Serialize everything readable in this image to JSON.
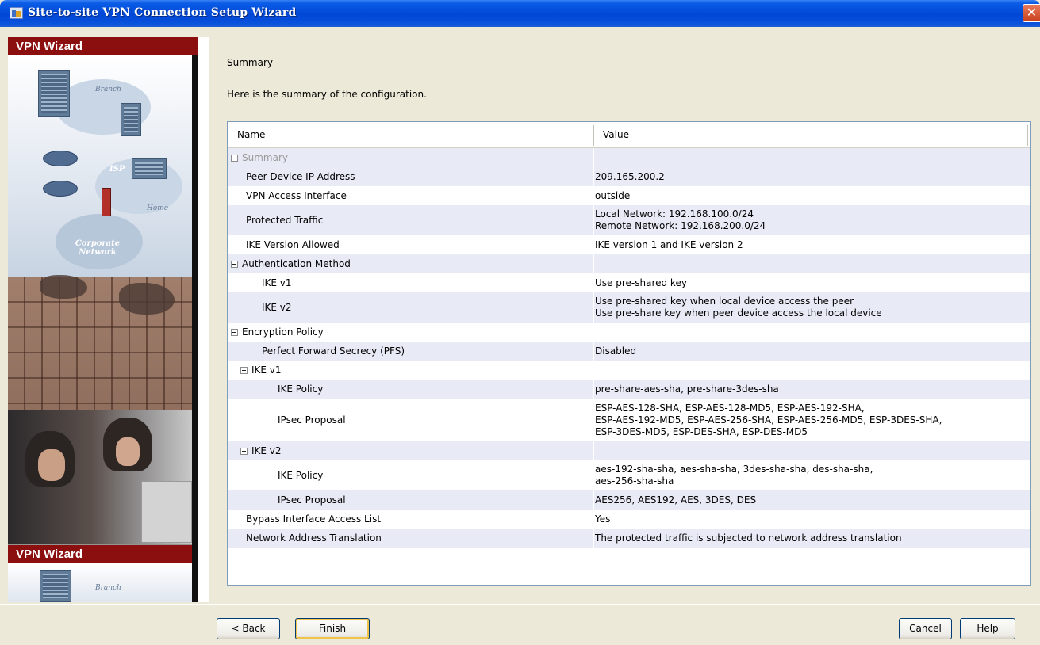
{
  "window": {
    "title": "Site-to-site VPN Connection Setup Wizard",
    "close_glyph": "✕"
  },
  "sidebar": {
    "label_top": "VPN Wizard",
    "label_bottom": "VPN Wizard",
    "illustration_labels": {
      "branch": "Branch",
      "isp": "ISP",
      "home": "Home",
      "corporate_network": "Corporate Network",
      "branch_bottom": "Branch"
    }
  },
  "page": {
    "title": "Summary",
    "subtitle": "Here is the summary of the configuration."
  },
  "table": {
    "columns": [
      "Name",
      "Value"
    ],
    "rows": [
      {
        "name": "Summary",
        "value": "",
        "level": 0,
        "expander": true,
        "grey": true,
        "alt": true
      },
      {
        "name": "Peer Device IP Address",
        "value": "209.165.200.2",
        "level": 1,
        "alt": true
      },
      {
        "name": "VPN Access Interface",
        "value": "outside",
        "level": 1,
        "alt": false
      },
      {
        "name": "Protected Traffic",
        "value": "Local Network: 192.168.100.0/24\nRemote Network: 192.168.200.0/24",
        "level": 1,
        "alt": true
      },
      {
        "name": "IKE Version Allowed",
        "value": "IKE version 1 and IKE version 2",
        "level": 1,
        "alt": false
      },
      {
        "name": "Authentication Method",
        "value": "",
        "level": 0,
        "expander": true,
        "alt": true
      },
      {
        "name": "IKE v1",
        "value": "Use pre-shared key",
        "level": 2,
        "alt": false
      },
      {
        "name": "IKE v2",
        "value": "Use pre-shared key when local device access the peer\nUse pre-share key when peer device access the local device",
        "level": 2,
        "alt": true
      },
      {
        "name": "Encryption Policy",
        "value": "",
        "level": 0,
        "expander": true,
        "alt": false
      },
      {
        "name": "Perfect Forward Secrecy (PFS)",
        "value": "Disabled",
        "level": 2,
        "alt": true
      },
      {
        "name": "IKE v1",
        "value": "",
        "level": 1,
        "expander": true,
        "alt": false
      },
      {
        "name": "IKE Policy",
        "value": "pre-share-aes-sha, pre-share-3des-sha",
        "level": 3,
        "alt": true
      },
      {
        "name": "IPsec Proposal",
        "value": "ESP-AES-128-SHA, ESP-AES-128-MD5, ESP-AES-192-SHA,\nESP-AES-192-MD5, ESP-AES-256-SHA, ESP-AES-256-MD5, ESP-3DES-SHA,\nESP-3DES-MD5, ESP-DES-SHA, ESP-DES-MD5",
        "level": 3,
        "alt": false
      },
      {
        "name": "IKE v2",
        "value": "",
        "level": 1,
        "expander": true,
        "alt": true
      },
      {
        "name": "IKE Policy",
        "value": "aes-192-sha-sha, aes-sha-sha, 3des-sha-sha, des-sha-sha,\naes-256-sha-sha",
        "level": 3,
        "alt": false
      },
      {
        "name": "IPsec Proposal",
        "value": "AES256, AES192, AES, 3DES, DES",
        "level": 3,
        "alt": true
      },
      {
        "name": "Bypass Interface Access List",
        "value": "Yes",
        "level": 1,
        "alt": false
      },
      {
        "name": "Network Address Translation",
        "value": "The protected traffic is subjected to network address translation",
        "level": 1,
        "alt": true
      }
    ]
  },
  "buttons": {
    "back": {
      "label": "< Back",
      "mnemonic": "B"
    },
    "finish": {
      "label": "Finish",
      "mnemonic": "F"
    },
    "cancel": {
      "label": "Cancel"
    },
    "help": {
      "label": "Help"
    }
  }
}
